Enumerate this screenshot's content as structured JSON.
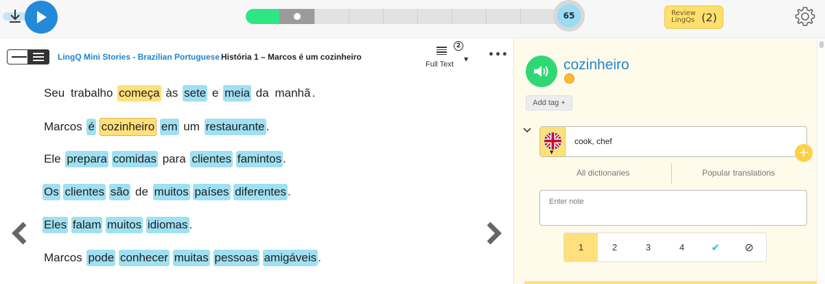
{
  "player": {
    "download_icon": "download-icon",
    "play_icon": "play-icon",
    "progress_percent": 65,
    "progress_label": "65"
  },
  "review": {
    "label": "Review LingQs",
    "count": "(2)"
  },
  "settings_icon": "gear-icon",
  "lesson_header": {
    "menu_icon": "sidebar-toggle-icon",
    "course": "LingQ Mini Stories - Brazilian Portuguese",
    "title": "História 1 – Marcos é um cozinheiro",
    "view_badge": "2",
    "view_mode": "Full Text",
    "more_icon": "more-icon",
    "more_label": "•••"
  },
  "reader": {
    "prev_icon": "chevron-left-icon",
    "next_icon": "chevron-right-icon",
    "sentences": [
      [
        {
          "t": "Seu",
          "s": "known"
        },
        {
          "t": "trabalho",
          "s": "known"
        },
        {
          "t": "começa",
          "s": "yellow"
        },
        {
          "t": "às",
          "s": "known"
        },
        {
          "t": "sete",
          "s": "blue"
        },
        {
          "t": "e",
          "s": "known"
        },
        {
          "t": "meia",
          "s": "blue"
        },
        {
          "t": "da",
          "s": "known"
        },
        {
          "t": "manhã",
          "s": "known"
        },
        {
          "t": ".",
          "s": "punct"
        }
      ],
      [
        {
          "t": "Marcos",
          "s": "known"
        },
        {
          "t": "é",
          "s": "blue"
        },
        {
          "t": "cozinheiro",
          "s": "selected"
        },
        {
          "t": "em",
          "s": "blue"
        },
        {
          "t": "um",
          "s": "known"
        },
        {
          "t": "restaurante",
          "s": "blue"
        },
        {
          "t": ".",
          "s": "punct"
        }
      ],
      [
        {
          "t": "Ele",
          "s": "known"
        },
        {
          "t": "prepara",
          "s": "blue"
        },
        {
          "t": "comidas",
          "s": "blue"
        },
        {
          "t": "para",
          "s": "known"
        },
        {
          "t": "clientes",
          "s": "blue"
        },
        {
          "t": "famintos",
          "s": "blue"
        },
        {
          "t": ".",
          "s": "punct"
        }
      ],
      [
        {
          "t": "Os",
          "s": "blue"
        },
        {
          "t": "clientes",
          "s": "blue"
        },
        {
          "t": "são",
          "s": "blue"
        },
        {
          "t": "de",
          "s": "known"
        },
        {
          "t": "muitos",
          "s": "blue"
        },
        {
          "t": "países",
          "s": "blue"
        },
        {
          "t": "diferentes",
          "s": "blue"
        },
        {
          "t": ".",
          "s": "punct"
        }
      ],
      [
        {
          "t": "Eles",
          "s": "blue"
        },
        {
          "t": "falam",
          "s": "blue"
        },
        {
          "t": "muitos",
          "s": "blue"
        },
        {
          "t": "idiomas",
          "s": "blue"
        },
        {
          "t": ".",
          "s": "punct"
        }
      ],
      [
        {
          "t": "Marcos",
          "s": "known"
        },
        {
          "t": "pode",
          "s": "blue"
        },
        {
          "t": "conhecer",
          "s": "blue"
        },
        {
          "t": "muitas",
          "s": "blue"
        },
        {
          "t": "pessoas",
          "s": "blue"
        },
        {
          "t": "amigáveis",
          "s": "blue"
        },
        {
          "t": ".",
          "s": "punct"
        }
      ]
    ]
  },
  "panel": {
    "speaker_icon": "speaker-icon",
    "term": "cozinheiro",
    "status_icon": "coin-icon",
    "add_tag": "Add tag +",
    "collapse_icon": "chevron-down-icon",
    "language_flag": "uk-flag-icon",
    "hint": "cook, chef",
    "add_hint_label": "+",
    "dict_all": "All dictionaries",
    "dict_popular": "Popular translations",
    "note_placeholder": "Enter note",
    "status_options": [
      "1",
      "2",
      "3",
      "4",
      "✔",
      "⊘"
    ],
    "status_active": "1"
  },
  "colors": {
    "accent_blue": "#2389d9",
    "lingq_blue": "#9fe0f2",
    "lingq_yellow": "#ffe07a",
    "progress_green": "#2ee683",
    "speaker_green": "#2ed872",
    "link_blue": "#1c84d0",
    "check_teal": "#22c3d6"
  }
}
